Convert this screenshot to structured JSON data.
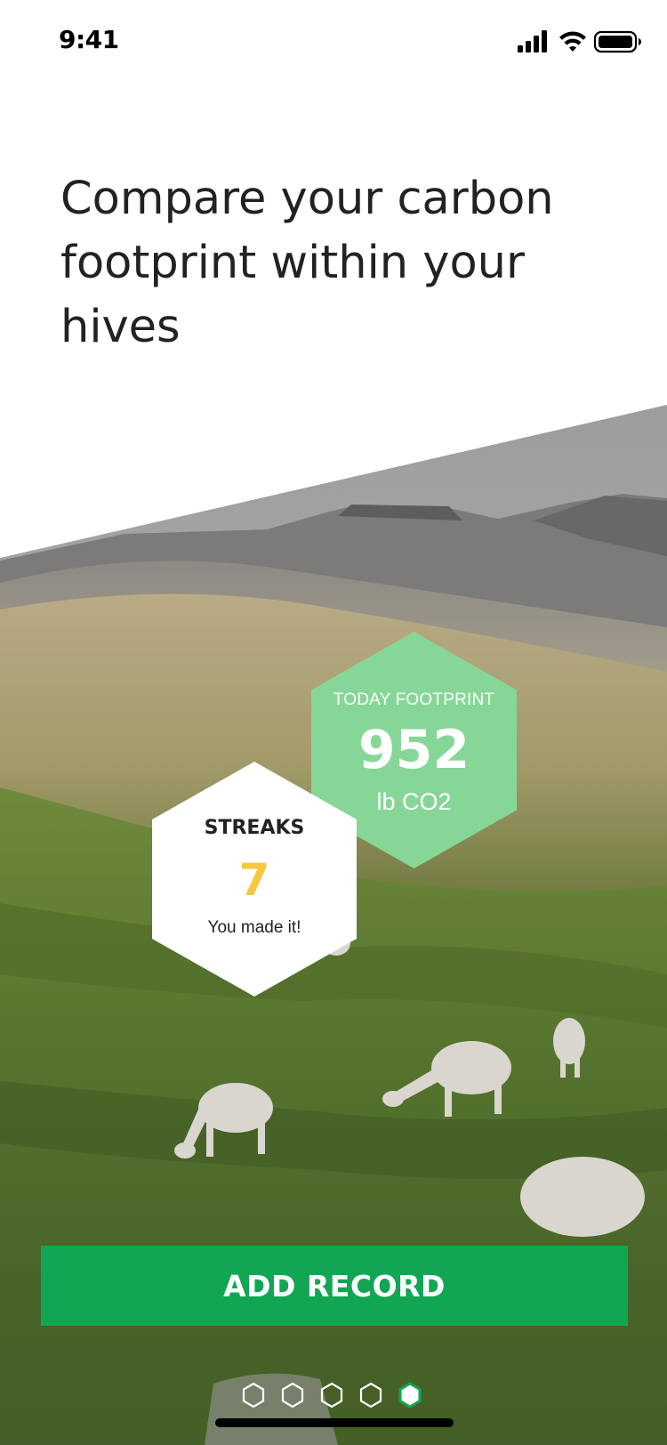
{
  "status_bar": {
    "time": "9:41",
    "icons": [
      "signal-icon",
      "wifi-icon",
      "battery-icon"
    ]
  },
  "headline": "Compare your carbon footprint within your hives",
  "footprint_card": {
    "label": "TODAY FOOTPRINT",
    "value": "952",
    "unit": "lb CO2",
    "color": "#86D797"
  },
  "streaks_card": {
    "label": "STREAKS",
    "value": "7",
    "subtitle": "You made it!",
    "value_color": "#F5C844"
  },
  "add_button": {
    "label": "ADD RECORD",
    "color": "#11A653"
  },
  "pager": {
    "total": 5,
    "active_index": 4,
    "icon": "hexagon-icon"
  },
  "colors": {
    "accent": "#11A653",
    "text": "#222222"
  }
}
